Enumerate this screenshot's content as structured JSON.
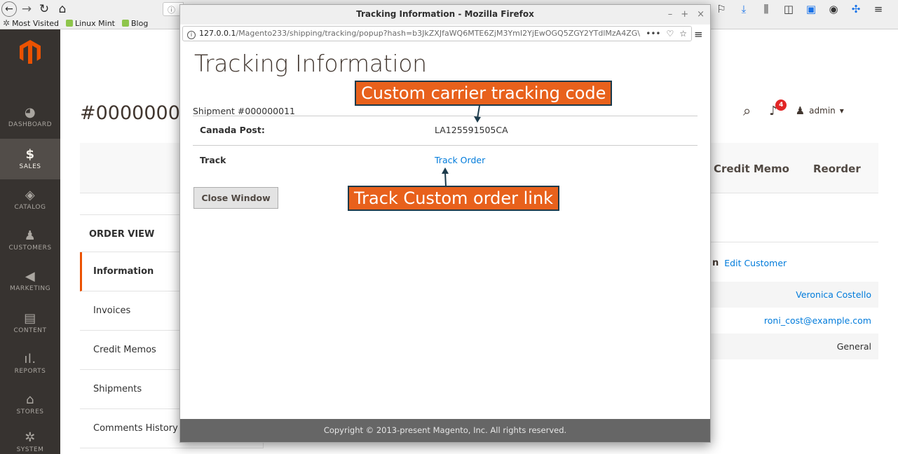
{
  "bookmarks": [
    "Most Visited",
    "Linux Mint",
    "Blog"
  ],
  "sidebar": {
    "items": [
      {
        "label": "DASHBOARD",
        "icon": "dashboard-icon",
        "glyph": "◕"
      },
      {
        "label": "SALES",
        "icon": "dollar-icon",
        "glyph": "$"
      },
      {
        "label": "CATALOG",
        "icon": "cube-icon",
        "glyph": "◈"
      },
      {
        "label": "CUSTOMERS",
        "icon": "person-icon",
        "glyph": "♟"
      },
      {
        "label": "MARKETING",
        "icon": "megaphone-icon",
        "glyph": "📢"
      },
      {
        "label": "CONTENT",
        "icon": "layout-icon",
        "glyph": "▤"
      },
      {
        "label": "REPORTS",
        "icon": "bar-chart-icon",
        "glyph": "▮"
      },
      {
        "label": "STORES",
        "icon": "store-icon",
        "glyph": "⌂"
      },
      {
        "label": "SYSTEM",
        "icon": "gear-icon",
        "glyph": "✲"
      }
    ]
  },
  "page": {
    "order_title": "#00000001",
    "admin_label": "admin",
    "notification_count": "4",
    "actions": {
      "credit_memo": "Credit Memo",
      "reorder": "Reorder"
    },
    "order_view": {
      "title": "ORDER VIEW",
      "tabs": [
        "Information",
        "Invoices",
        "Credit Memos",
        "Shipments",
        "Comments History"
      ]
    },
    "account": {
      "heading_fragment": "n",
      "edit_link": "Edit Customer",
      "name": "Veronica Costello",
      "email": "roni_cost@example.com",
      "group": "General"
    }
  },
  "popup": {
    "window_title": "Tracking Information - Mozilla Firefox",
    "url_host": "127.0.0.1",
    "url_path": "/Magento233/shipping/tracking/popup?hash=b3JkZXJfaWQ6MTE6ZjM3YmI2YjEwOGQ5ZGY2YTdlMzA4ZG\\",
    "url_more": "•••",
    "heading": "Tracking Information",
    "shipment_label": "Shipment #000000011",
    "carrier_label": "Canada Post:",
    "tracking_number": "LA125591505CA",
    "track_label": "Track",
    "track_link": "Track Order",
    "close_button": "Close Window",
    "footer": "Copyright © 2013-present Magento, Inc. All rights reserved."
  },
  "annotations": {
    "callout_1": "Custom carrier tracking code",
    "callout_2": "Track Custom order link"
  }
}
